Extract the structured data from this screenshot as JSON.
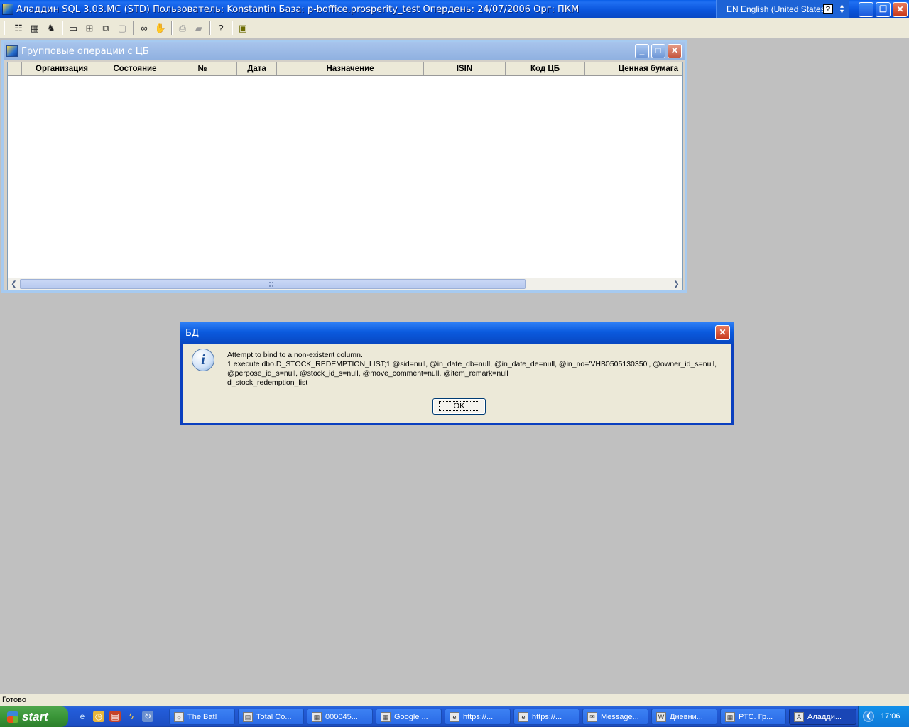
{
  "app": {
    "title": "Аладдин SQL 3.03.MC (STD)  Пользователь: Konstantin База: p-boffice.prosperity_test Опердень: 24/07/2006 Орг: ПКМ",
    "language": "EN English (United States)",
    "help_symbol": "?"
  },
  "toolbar": {
    "icons": [
      "list-icon",
      "database-icon",
      "users-icon",
      "window-icon",
      "tile-icon",
      "cascade-icon",
      "screen-icon",
      "binoculars-icon",
      "stop-icon",
      "print-icon",
      "export-icon",
      "help-icon",
      "exit-icon"
    ]
  },
  "child_window": {
    "title": "Групповые операции с ЦБ",
    "columns": [
      "Организация",
      "Состояние",
      "№",
      "Дата",
      "Назначение",
      "ISIN",
      "Код ЦБ",
      "Ценная бумага"
    ],
    "rows": []
  },
  "dialog": {
    "title": "БД",
    "message": "Attempt to bind to a non-existent column.\n1 execute dbo.D_STOCK_REDEMPTION_LIST;1 @sid=null, @in_date_db=null, @in_date_de=null, @in_no='VHB0505130350', @owner_id_s=null,\n@perpose_id_s=null, @stock_id_s=null, @move_comment=null, @item_remark=null\nd_stock_redemption_list",
    "ok_label": "OK"
  },
  "statusbar": {
    "text": "Готово"
  },
  "taskbar": {
    "start_label": "start",
    "tasks": [
      "The Bat!",
      "Total Co...",
      "000045...",
      "Google ...",
      "https://...",
      "https://...",
      "Message...",
      "Дневни...",
      "РТС. Гр...",
      "Аладди..."
    ],
    "active_task": "Аладди...",
    "clock": "17:06"
  }
}
